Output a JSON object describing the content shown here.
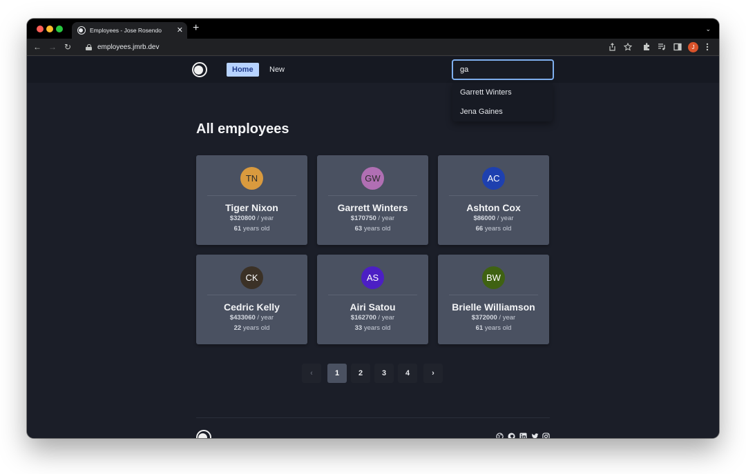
{
  "browser": {
    "tab_title": "Employees - Jose Rosendo",
    "tab_close": "✕",
    "new_tab": "+",
    "tab_menu": "⌄",
    "url": "employees.jmrb.dev",
    "profile_initial": "J",
    "controls": {
      "back": "←",
      "forward": "→",
      "reload": "↻"
    },
    "icons": [
      "share-icon",
      "bookmark-star-icon",
      "extensions-icon",
      "media-icon",
      "side-panel-icon",
      "menu-icon"
    ]
  },
  "nav": {
    "links": [
      {
        "label": "Home",
        "active": true
      },
      {
        "label": "New",
        "active": false
      }
    ]
  },
  "search": {
    "value": "ga",
    "suggestions": [
      "Garrett Winters",
      "Jena Gaines"
    ]
  },
  "main": {
    "title": "All employees",
    "employees": [
      {
        "initials": "TN",
        "name": "Tiger Nixon",
        "salary": "$320800",
        "salary_unit": " / year",
        "age": "61",
        "age_unit": " years old",
        "color": "#d99a3e",
        "text_color": "#2a2a2a"
      },
      {
        "initials": "GW",
        "name": "Garrett Winters",
        "salary": "$170750",
        "salary_unit": " / year",
        "age": "63",
        "age_unit": " years old",
        "color": "#b06fb3",
        "text_color": "#2a2a2a"
      },
      {
        "initials": "AC",
        "name": "Ashton Cox",
        "salary": "$86000",
        "salary_unit": " / year",
        "age": "66",
        "age_unit": " years old",
        "color": "#1e40af",
        "text_color": "#ffffff"
      },
      {
        "initials": "CK",
        "name": "Cedric Kelly",
        "salary": "$433060",
        "salary_unit": " / year",
        "age": "22",
        "age_unit": " years old",
        "color": "#3b3126",
        "text_color": "#ffffff"
      },
      {
        "initials": "AS",
        "name": "Airi Satou",
        "salary": "$162700",
        "salary_unit": " / year",
        "age": "33",
        "age_unit": " years old",
        "color": "#4c1fc4",
        "text_color": "#ffffff"
      },
      {
        "initials": "BW",
        "name": "Brielle Williamson",
        "salary": "$372000",
        "salary_unit": " / year",
        "age": "61",
        "age_unit": " years old",
        "color": "#3f6212",
        "text_color": "#ffffff"
      }
    ]
  },
  "pagination": {
    "prev": "‹",
    "next": "›",
    "pages": [
      "1",
      "2",
      "3",
      "4"
    ],
    "current": "1"
  },
  "footer": {
    "social": [
      "globe-icon",
      "github-icon",
      "linkedin-icon",
      "twitter-icon",
      "instagram-icon"
    ]
  },
  "colors": {
    "page_bg": "#1b1e28",
    "nav_bg": "#161922",
    "card_bg": "#4a5161",
    "accent": "#b7d3ff",
    "search_border": "#7fb0f0"
  }
}
